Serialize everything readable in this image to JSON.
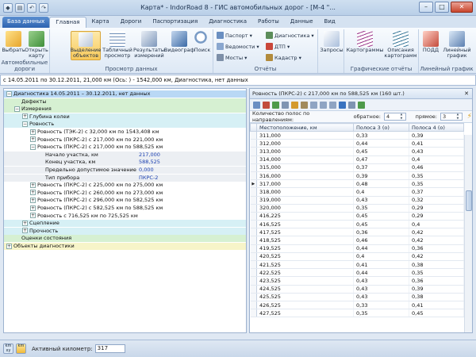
{
  "window": {
    "title": "Карта* - IndorRoad 8 - ГИС автомобильных дорог - [М-4 \"...",
    "controls": [
      "–",
      "□",
      "✕"
    ]
  },
  "ribbon_tabs": [
    "База данных",
    "Главная",
    "Карта",
    "Дороги",
    "Паспортизация",
    "Диагностика",
    "Работы",
    "Данные",
    "Вид"
  ],
  "ribbon_groups": {
    "roads": {
      "label": "Автомобильные дороги",
      "select": "Выбрать",
      "open": "Открыть\nкарту"
    },
    "view": {
      "label": "Просмотр данных",
      "selection": "Выделение\nобъектов",
      "table": "Табличный\nпросмотр",
      "results": "Результаты\nизмерений",
      "video": "Видеограф",
      "search": "Поиск"
    },
    "reports": {
      "label": "Отчёты",
      "items": [
        "Паспорт",
        "Ведомости",
        "Мосты",
        "Диагностика",
        "ДТП",
        "Кадастр"
      ],
      "requests": "Запросы"
    },
    "graphic": {
      "label": "Графические отчёты",
      "cartograms": "Картограммы",
      "descriptions": "Описания\nкартограмм"
    },
    "linear": {
      "label": "Линейный график",
      "podd": "ПОДД",
      "linear": "Линейный\nграфик"
    }
  },
  "infobar": "с 14.05.2011 по 30.12.2011, 21,000 км (Ось: ) - 1542,000 км, Диагностика, нет данных",
  "tree": [
    {
      "text": "Диагностика 14.05.2011 – 30.12.2011, нет данных",
      "level": 0,
      "tog": "−",
      "bg": "#b9d8f5"
    },
    {
      "text": "Дефекты",
      "level": 1,
      "tog": "",
      "bg": "#d6f0d2"
    },
    {
      "text": "Измерения",
      "level": 1,
      "tog": "−",
      "bg": "#d6f0d2"
    },
    {
      "text": "Глубина колеи",
      "level": 2,
      "tog": "+",
      "bg": "#d6f0f5"
    },
    {
      "text": "Ровность",
      "level": 2,
      "tog": "−",
      "bg": "#d6f0f5"
    },
    {
      "text": "Ровность (ТЭК-2) с 32,000 км по 1543,408 км",
      "level": 3,
      "tog": "+",
      "bg": "#fff"
    },
    {
      "text": "Ровность (ПКРС-2) с 217,000 км по 221,000 км",
      "level": 3,
      "tog": "+",
      "bg": "#fff"
    },
    {
      "text": "Ровность (ПКРС-2) с 217,000 км по 588,525 км",
      "level": 3,
      "tog": "−",
      "bg": "#fff"
    },
    {
      "text": "Начало участка, км",
      "level": 4,
      "tog": "",
      "bg": "#eceff3",
      "value": "217,000"
    },
    {
      "text": "Конец участка, км",
      "level": 4,
      "tog": "",
      "bg": "#eceff3",
      "value": "588,525"
    },
    {
      "text": "Предельно допустимое значение",
      "level": 4,
      "tog": "",
      "bg": "#eceff3",
      "value": "0,000"
    },
    {
      "text": "Тип прибора",
      "level": 4,
      "tog": "",
      "bg": "#eceff3",
      "value": "ПКРС-2"
    },
    {
      "text": "Ровность (ПКРС-2) с 225,000 км по 275,000 км",
      "level": 3,
      "tog": "+",
      "bg": "#fff"
    },
    {
      "text": "Ровность (ПКРС-2) с 260,000 км по 273,000 км",
      "level": 3,
      "tog": "+",
      "bg": "#fff"
    },
    {
      "text": "Ровность (ПКРС-2) с 296,000 км по 582,525 км",
      "level": 3,
      "tog": "+",
      "bg": "#fff"
    },
    {
      "text": "Ровность (ПКРС-2) с 582,525 км по 588,525 км",
      "level": 3,
      "tog": "+",
      "bg": "#fff"
    },
    {
      "text": "Ровность с 716,525 км по 725,525 км",
      "level": 3,
      "tog": "+",
      "bg": "#fff"
    },
    {
      "text": "Сцепление",
      "level": 2,
      "tog": "+",
      "bg": "#d6f0f5"
    },
    {
      "text": "Прочность",
      "level": 2,
      "tog": "+",
      "bg": "#d6f0f5"
    },
    {
      "text": "Оценки состояния",
      "level": 1,
      "tog": "",
      "bg": "#d6f0d2"
    },
    {
      "text": "Объекты диагностики",
      "level": 0,
      "tog": "+",
      "bg": "#f7f4c9"
    }
  ],
  "right_panel": {
    "title": "Ровность (ПКРС-2) с 217,000 км по 588,525 км (160 шт.)",
    "lanes_label": "Количество полос по направлениям:",
    "reverse_label": "обратное:",
    "reverse_value": "4",
    "forward_label": "прямое:",
    "forward_value": "3",
    "columns": [
      "Местоположение, км",
      "Полоса 3 (о)",
      "Полоса 4 (о)"
    ],
    "current_row": 6,
    "rows": [
      [
        "311,000",
        "0,33",
        "0,39"
      ],
      [
        "312,000",
        "0,44",
        "0,41"
      ],
      [
        "313,000",
        "0,45",
        "0,43"
      ],
      [
        "314,000",
        "0,47",
        "0,4"
      ],
      [
        "315,000",
        "0,37",
        "0,46"
      ],
      [
        "316,000",
        "0,39",
        "0,35"
      ],
      [
        "317,000",
        "0,48",
        "0,35"
      ],
      [
        "318,000",
        "0,4",
        "0,37"
      ],
      [
        "319,000",
        "0,43",
        "0,32"
      ],
      [
        "320,000",
        "0,35",
        "0,29"
      ],
      [
        "416,225",
        "0,45",
        "0,29"
      ],
      [
        "416,525",
        "0,45",
        "0,4"
      ],
      [
        "417,525",
        "0,36",
        "0,42"
      ],
      [
        "418,525",
        "0,46",
        "0,42"
      ],
      [
        "419,525",
        "0,44",
        "0,36"
      ],
      [
        "420,525",
        "0,4",
        "0,42"
      ],
      [
        "421,525",
        "0,41",
        "0,38"
      ],
      [
        "422,525",
        "0,44",
        "0,35"
      ],
      [
        "423,525",
        "0,43",
        "0,36"
      ],
      [
        "424,525",
        "0,43",
        "0,39"
      ],
      [
        "425,525",
        "0,43",
        "0,38"
      ],
      [
        "426,525",
        "0,33",
        "0,41"
      ],
      [
        "427,525",
        "0,35",
        "0,45"
      ]
    ]
  },
  "status": {
    "active_km_label": "Активный километр:",
    "active_km_value": "317"
  }
}
